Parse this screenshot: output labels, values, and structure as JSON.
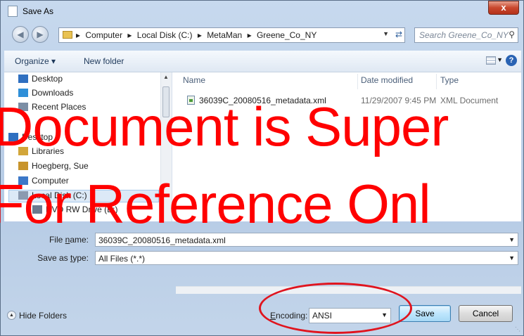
{
  "window": {
    "title": "Save As",
    "close_symbol": "x"
  },
  "address": {
    "breadcrumbs": [
      "Computer",
      "Local Disk (C:)",
      "MetaMan",
      "Greene_Co_NY"
    ],
    "separator": "▸",
    "search_placeholder": "Search Greene_Co_NY"
  },
  "toolbar": {
    "organize": "Organize ▾",
    "new_folder": "New folder",
    "help": "?"
  },
  "nav": {
    "items": [
      {
        "label": "Desktop",
        "icon": "desktop-icon",
        "color": "#2f6fc0"
      },
      {
        "label": "Downloads",
        "icon": "downloads-icon",
        "color": "#2f8fd8"
      },
      {
        "label": "Recent Places",
        "icon": "recent-places-icon",
        "color": "#7c8ea5"
      },
      {
        "label": "Desktop",
        "icon": "desktop-icon",
        "color": "#2f6fc0"
      },
      {
        "label": "Libraries",
        "icon": "libraries-icon",
        "color": "#d2a63a"
      },
      {
        "label": "Hoegberg, Sue",
        "icon": "user-folder-icon",
        "color": "#c8942c"
      },
      {
        "label": "Computer",
        "icon": "computer-icon",
        "color": "#3c78c8"
      },
      {
        "label": "Local Disk (C:)",
        "icon": "local-disk-icon",
        "color": "#8b9ab0"
      },
      {
        "label": "DVD RW Drive (E:)",
        "icon": "dvd-drive-icon",
        "color": "#6b7a8f"
      }
    ]
  },
  "files": {
    "columns": [
      "Name",
      "Date modified",
      "Type"
    ],
    "rows": [
      {
        "name": "36039C_20080516_metadata.xml",
        "date": "11/29/2007 9:45 PM",
        "type": "XML Document"
      }
    ]
  },
  "form": {
    "filename_label_pre": "File ",
    "filename_label_key": "n",
    "filename_label_post": "ame:",
    "filename_value": "36039C_20080516_metadata.xml",
    "savetype_label_pre": "Save as ",
    "savetype_label_key": "t",
    "savetype_label_post": "ype:",
    "savetype_value": "All Files (*.*)"
  },
  "footer": {
    "hide_folders": "Hide Folders",
    "encoding_label_pre": "E",
    "encoding_label_post": "ncoding:",
    "encoding_value": "ANSI",
    "save": "Save",
    "cancel": "Cancel"
  },
  "watermark": {
    "line1": "Document is Super",
    "line2": "For Reference Onl"
  },
  "colors": {
    "accent": "#2a63b3",
    "annotation": "#e0141e",
    "watermark": "#ff0000"
  }
}
